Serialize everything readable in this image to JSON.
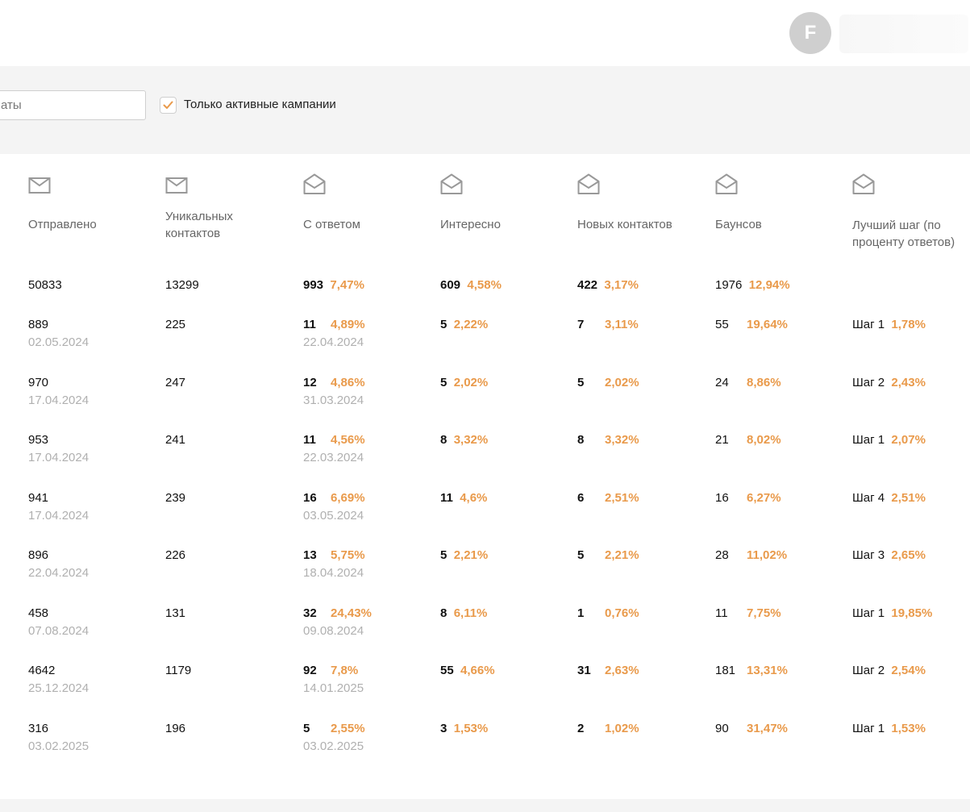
{
  "header": {
    "avatar_letter": "F"
  },
  "filters": {
    "date_placeholder": "аты",
    "only_active_label": "Только активные кампании",
    "only_active_checked": true
  },
  "colors": {
    "accent": "#e99a4b",
    "muted": "#b0b0b0"
  },
  "columns": [
    {
      "label": "Отправлено",
      "icon": "envelope-closed-icon"
    },
    {
      "label": "Уникальных контактов",
      "icon": "envelope-closed-icon"
    },
    {
      "label": "С ответом",
      "icon": "envelope-open-icon"
    },
    {
      "label": "Интересно",
      "icon": "envelope-open-icon"
    },
    {
      "label": "Новых контактов",
      "icon": "envelope-open-icon"
    },
    {
      "label": "Баунсов",
      "icon": "envelope-open-icon"
    },
    {
      "label": "Лучший шаг (по проценту ответов)",
      "icon": "envelope-open-icon"
    }
  ],
  "totals": {
    "sent": "50833",
    "unique": "13299",
    "replied": "993",
    "replied_pct": "7,47%",
    "interested": "609",
    "interested_pct": "4,58%",
    "new_contacts": "422",
    "new_contacts_pct": "3,17%",
    "bounces": "1976",
    "bounces_pct": "12,94%"
  },
  "rows": [
    {
      "sent": "889",
      "sent_date": "02.05.2024",
      "unique": "225",
      "replied": "11",
      "replied_pct": "4,89%",
      "replied_date": "22.04.2024",
      "interested": "5",
      "interested_pct": "2,22%",
      "new_contacts": "7",
      "new_contacts_pct": "3,11%",
      "bounces": "55",
      "bounces_pct": "19,64%",
      "best_step": "Шаг 1",
      "best_step_pct": "1,78%"
    },
    {
      "sent": "970",
      "sent_date": "17.04.2024",
      "unique": "247",
      "replied": "12",
      "replied_pct": "4,86%",
      "replied_date": "31.03.2024",
      "interested": "5",
      "interested_pct": "2,02%",
      "new_contacts": "5",
      "new_contacts_pct": "2,02%",
      "bounces": "24",
      "bounces_pct": "8,86%",
      "best_step": "Шаг 2",
      "best_step_pct": "2,43%"
    },
    {
      "sent": "953",
      "sent_date": "17.04.2024",
      "unique": "241",
      "replied": "11",
      "replied_pct": "4,56%",
      "replied_date": "22.03.2024",
      "interested": "8",
      "interested_pct": "3,32%",
      "new_contacts": "8",
      "new_contacts_pct": "3,32%",
      "bounces": "21",
      "bounces_pct": "8,02%",
      "best_step": "Шаг 1",
      "best_step_pct": "2,07%"
    },
    {
      "sent": "941",
      "sent_date": "17.04.2024",
      "unique": "239",
      "replied": "16",
      "replied_pct": "6,69%",
      "replied_date": "03.05.2024",
      "interested": "11",
      "interested_pct": "4,6%",
      "new_contacts": "6",
      "new_contacts_pct": "2,51%",
      "bounces": "16",
      "bounces_pct": "6,27%",
      "best_step": "Шаг 4",
      "best_step_pct": "2,51%"
    },
    {
      "sent": "896",
      "sent_date": "22.04.2024",
      "unique": "226",
      "replied": "13",
      "replied_pct": "5,75%",
      "replied_date": "18.04.2024",
      "interested": "5",
      "interested_pct": "2,21%",
      "new_contacts": "5",
      "new_contacts_pct": "2,21%",
      "bounces": "28",
      "bounces_pct": "11,02%",
      "best_step": "Шаг 3",
      "best_step_pct": "2,65%"
    },
    {
      "sent": "458",
      "sent_date": "07.08.2024",
      "unique": "131",
      "replied": "32",
      "replied_pct": "24,43%",
      "replied_date": "09.08.2024",
      "interested": "8",
      "interested_pct": "6,11%",
      "new_contacts": "1",
      "new_contacts_pct": "0,76%",
      "bounces": "11",
      "bounces_pct": "7,75%",
      "best_step": "Шаг 1",
      "best_step_pct": "19,85%"
    },
    {
      "sent": "4642",
      "sent_date": "25.12.2024",
      "unique": "1179",
      "replied": "92",
      "replied_pct": "7,8%",
      "replied_date": "14.01.2025",
      "interested": "55",
      "interested_pct": "4,66%",
      "new_contacts": "31",
      "new_contacts_pct": "2,63%",
      "bounces": "181",
      "bounces_pct": "13,31%",
      "best_step": "Шаг 2",
      "best_step_pct": "2,54%"
    },
    {
      "sent": "316",
      "sent_date": "03.02.2025",
      "unique": "196",
      "replied": "5",
      "replied_pct": "2,55%",
      "replied_date": "03.02.2025",
      "interested": "3",
      "interested_pct": "1,53%",
      "new_contacts": "2",
      "new_contacts_pct": "1,02%",
      "bounces": "90",
      "bounces_pct": "31,47%",
      "best_step": "Шаг 1",
      "best_step_pct": "1,53%"
    }
  ]
}
